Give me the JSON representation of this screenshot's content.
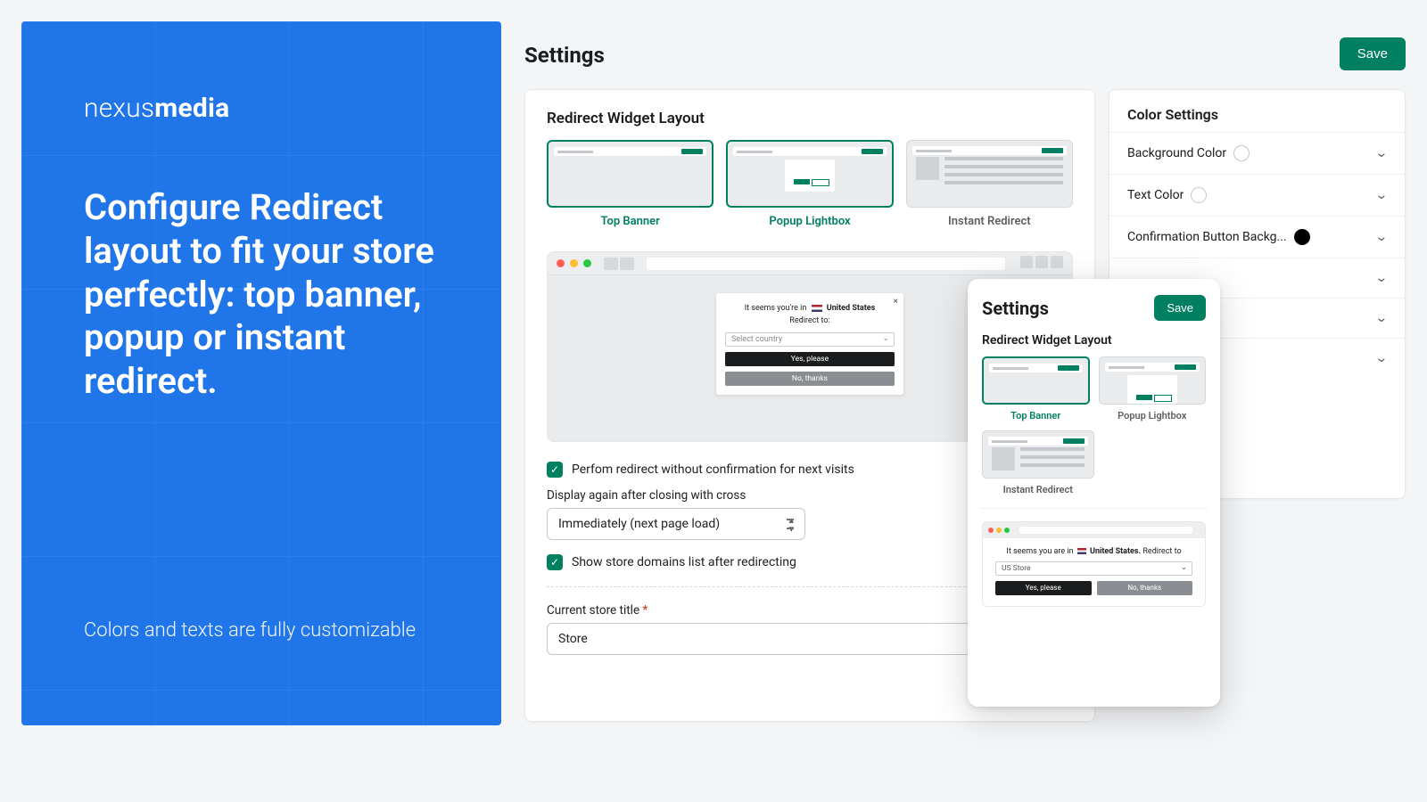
{
  "hero": {
    "brand_light": "nexus",
    "brand_bold": "media",
    "headline": "Configure Redirect layout to fit your store perfectly: top banner, popup or instant redirect.",
    "sub": "Colors and texts are fully customizable"
  },
  "page": {
    "title": "Settings",
    "save": "Save"
  },
  "layout_card": {
    "title": "Redirect Widget Layout",
    "options": [
      {
        "label": "Top Banner"
      },
      {
        "label": "Popup Lightbox"
      },
      {
        "label": "Instant Redirect"
      }
    ]
  },
  "preview_popup": {
    "line1_prefix": "It seems you're in",
    "country": "United States",
    "line2": "Redirect to:",
    "select_placeholder": "Select country",
    "yes": "Yes, please",
    "no": "No, thanks"
  },
  "options": {
    "check1": "Perfom redirect without confirmation for next visits",
    "display_label": "Display again after closing with cross",
    "display_value": "Immediately (next page load)",
    "check2": "Show store domains list after redirecting",
    "title_label": "Current store title",
    "title_value": "Store"
  },
  "colors": {
    "title": "Color Settings",
    "rows": [
      {
        "label": "Background Color",
        "swatch": "white"
      },
      {
        "label": "Text Color",
        "swatch": "white"
      },
      {
        "label": "Confirmation Button Backg...",
        "swatch": "black"
      }
    ]
  },
  "overlay": {
    "title": "Settings",
    "save": "Save",
    "section": "Redirect Widget Layout",
    "options": [
      {
        "label": "Top Banner"
      },
      {
        "label": "Popup Lightbox"
      },
      {
        "label": "Instant Redirect"
      }
    ],
    "preview": {
      "line": "It seems you are in",
      "country": "United States.",
      "suffix": "Redirect to",
      "select": "US Store",
      "yes": "Yes, please",
      "no": "No, thanks"
    }
  }
}
